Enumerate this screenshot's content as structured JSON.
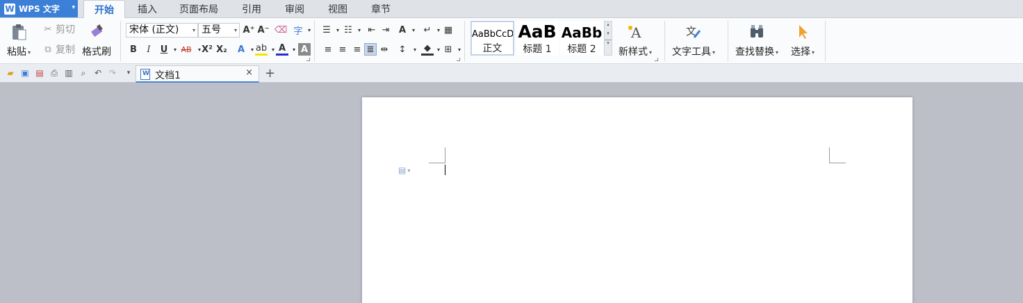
{
  "app": {
    "name": "WPS 文字",
    "logo_letter": "W"
  },
  "menu": {
    "tabs": [
      "开始",
      "插入",
      "页面布局",
      "引用",
      "审阅",
      "视图",
      "章节"
    ],
    "active_index": 0
  },
  "ribbon": {
    "clipboard": {
      "paste": "粘贴",
      "cut": "剪切",
      "copy": "复制",
      "format_painter": "格式刷"
    },
    "font": {
      "family": "宋体 (正文)",
      "size": "五号",
      "grow": "A⁺",
      "shrink": "A⁻",
      "bold": "B",
      "italic": "I",
      "underline": "U",
      "strike": "AB",
      "superscript": "X²",
      "subscript": "X₂"
    },
    "styles": [
      {
        "sample": "AaBbCcD",
        "name": "正文"
      },
      {
        "sample": "AaB",
        "name": "标题 1"
      },
      {
        "sample": "AaBb",
        "name": "标题 2"
      }
    ],
    "new_style": "新样式",
    "text_tools": "文字工具",
    "find_replace": "查找替换",
    "select": "选择"
  },
  "document_tab": {
    "name": "文档1",
    "close": "×",
    "new": "+"
  },
  "colors": {
    "accent": "#3c7fd7",
    "highlight": "#f5e400",
    "font_color": "#2b2bd6"
  }
}
